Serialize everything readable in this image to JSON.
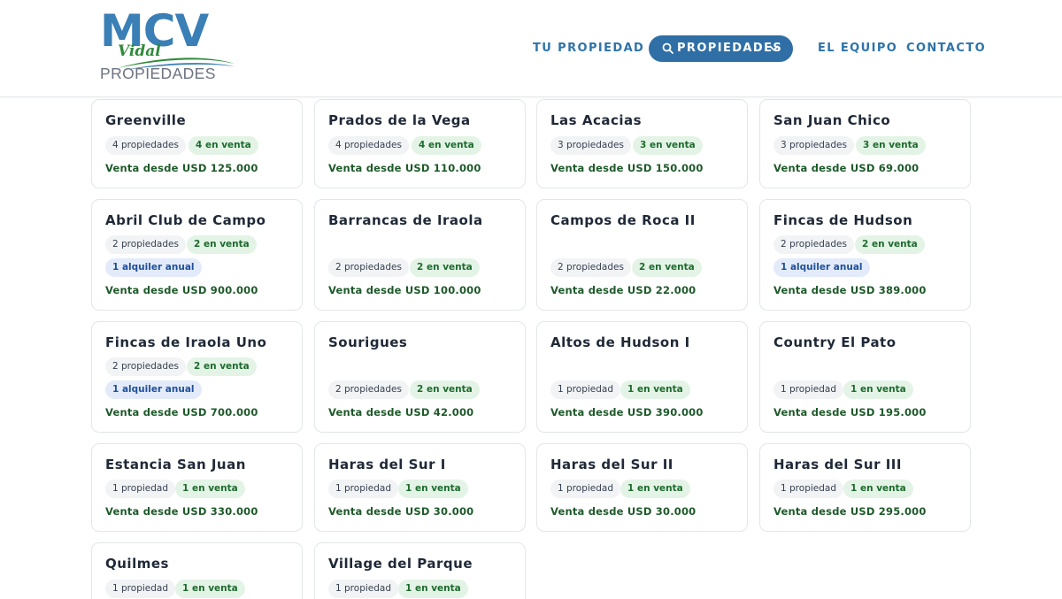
{
  "brand": {
    "logo_main": "MCV",
    "logo_script": "Vidal",
    "logo_sub": "PROPIEDADES",
    "colors": {
      "blue": "#3a7fb6",
      "green": "#2f8a3a",
      "gray": "#6b7280"
    }
  },
  "nav": {
    "tu_propiedad": "TU PROPIEDAD",
    "propiedades": "PROPIEDADES",
    "el_equipo": "EL EQUIPO",
    "contacto": "CONTACTO",
    "icons": [
      "search-icon",
      "chevron-down-icon"
    ]
  },
  "theme": {
    "nav_color": "#2f73a8",
    "pill_bg": "#2f6fa6",
    "price_color": "#1e5a2a",
    "badge_green_bg": "#e3f4e6",
    "badge_blue_bg": "#e3ebfb"
  },
  "cards": [
    {
      "name": "Greenville",
      "count": "4 propiedades",
      "sale": "4 en venta",
      "price": "Venta desde USD 125.000"
    },
    {
      "name": "Prados de la Vega",
      "count": "4 propiedades",
      "sale": "4 en venta",
      "price": "Venta desde USD 110.000"
    },
    {
      "name": "Las Acacias",
      "count": "3 propiedades",
      "sale": "3 en venta",
      "price": "Venta desde USD 150.000"
    },
    {
      "name": "San Juan Chico",
      "count": "3 propiedades",
      "sale": "3 en venta",
      "price": "Venta desde USD 69.000"
    },
    {
      "name": "Abril Club de Campo",
      "count": "2 propiedades",
      "sale": "2 en venta",
      "rent": "1 alquiler anual",
      "price": "Venta desde USD 900.000"
    },
    {
      "name": "Barrancas de Iraola",
      "count": "2 propiedades",
      "sale": "2 en venta",
      "price": "Venta desde USD 100.000"
    },
    {
      "name": "Campos de Roca II",
      "count": "2 propiedades",
      "sale": "2 en venta",
      "price": "Venta desde USD 22.000"
    },
    {
      "name": "Fincas de Hudson",
      "count": "2 propiedades",
      "sale": "2 en venta",
      "rent": "1 alquiler anual",
      "price": "Venta desde USD 389.000"
    },
    {
      "name": "Fincas de Iraola Uno",
      "count": "2 propiedades",
      "sale": "2 en venta",
      "rent": "1 alquiler anual",
      "price": "Venta desde USD 700.000"
    },
    {
      "name": "Sourigues",
      "count": "2 propiedades",
      "sale": "2 en venta",
      "price": "Venta desde USD 42.000"
    },
    {
      "name": "Altos de Hudson I",
      "count": "1 propiedad",
      "sale": "1 en venta",
      "price": "Venta desde USD 390.000"
    },
    {
      "name": "Country El Pato",
      "count": "1 propiedad",
      "sale": "1 en venta",
      "price": "Venta desde USD 195.000"
    },
    {
      "name": "Estancia San Juan",
      "count": "1 propiedad",
      "sale": "1 en venta",
      "price": "Venta desde USD 330.000"
    },
    {
      "name": "Haras del Sur I",
      "count": "1 propiedad",
      "sale": "1 en venta",
      "price": "Venta desde USD 30.000"
    },
    {
      "name": "Haras del Sur II",
      "count": "1 propiedad",
      "sale": "1 en venta",
      "price": "Venta desde USD 30.000"
    },
    {
      "name": "Haras del Sur III",
      "count": "1 propiedad",
      "sale": "1 en venta",
      "price": "Venta desde USD 295.000"
    },
    {
      "name": "Quilmes",
      "count": "1 propiedad",
      "sale": "1 en venta"
    },
    {
      "name": "Village del Parque",
      "count": "1 propiedad",
      "sale": "1 en venta"
    }
  ]
}
